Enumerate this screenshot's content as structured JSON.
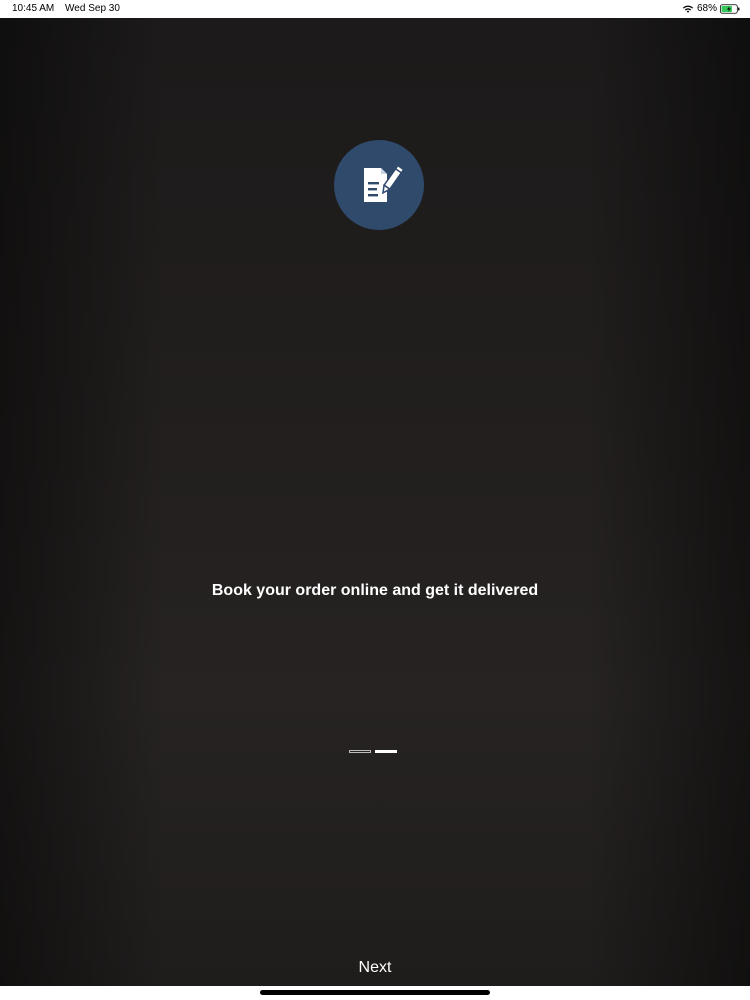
{
  "status_bar": {
    "time": "10:45 AM",
    "date": "Wed Sep 30",
    "battery_percent": "68%",
    "wifi_icon": "wifi-icon",
    "battery_icon": "battery-charging-icon"
  },
  "onboarding": {
    "logo_icon": "edit-document-icon",
    "logo_color": "#2f4a6b",
    "headline": "Book your order online and get it delivered",
    "pager": {
      "total_pages": 2,
      "current_page": 2
    },
    "next_label": "Next"
  }
}
